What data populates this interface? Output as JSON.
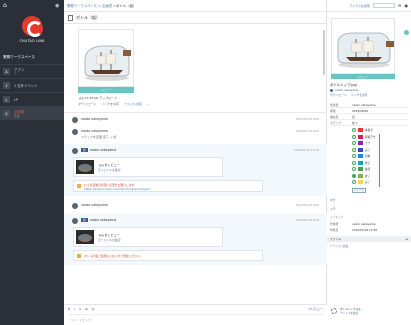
{
  "sidebar": {
    "logo_text": "CHUTAO LINK",
    "section_label": "業務ワークスペース",
    "items": [
      {
        "badge": "A",
        "label": "アプリ",
        "sub": "ア"
      },
      {
        "badge": "1",
        "label": "1 社外イベント",
        "sub": ""
      },
      {
        "badge": "L",
        "label": "LP",
        "sub": ""
      },
      {
        "badge": "S",
        "label": "企画書",
        "sub": "企画"
      }
    ]
  },
  "header": {
    "breadcrumb": "業務ワークスペース > 企画書 > ",
    "breadcrumb_current": "ボトル（仮）",
    "search_label": "アイテムを検索"
  },
  "title_bar": {
    "title": "ボトル（仮）"
  },
  "main": {
    "preview_button": "レビュー",
    "file_info": ".jpg 13.58 KB アップロード",
    "file_actions": [
      "ダウンロード",
      "リンクを共有",
      "ファイル共有",
      "…"
    ],
    "messages": [
      {
        "name": "naoto nakayama",
        "time": "2019/01/18 8:00",
        "text": ""
      },
      {
        "name": "naoto nakayama",
        "time": "2019/01/18 8:00",
        "text": "ステップを変更  完了 → 仮"
      }
    ],
    "highlight": {
      "tag": "仮",
      "name": "naoto nakayama",
      "time": "2019/01/18 13:38",
      "attachment_name": ".jpg をレビュー",
      "attachment_link": "元ファイルを確認",
      "note_text": "ロゴを画像の意図に変更をお願いします。",
      "note_url": "https://www.dropbox.com/home/xg/work/logo/d"
    },
    "message3": {
      "name": "naoto nakayama",
      "time": "2019/01/18 8:00"
    },
    "highlight2": {
      "tag": "仮",
      "name": "naoto nakayama",
      "time": "2019/01/18 8:38",
      "attachment_name": ".jpg をレビュー",
      "attachment_link": "元ファイルを確認",
      "note_text": "ボトルの瓶と装飾もいないかで修復ください。"
    },
    "footer": {
      "tools": [
        "B",
        "I",
        "U",
        "⊞",
        "@"
      ],
      "preview_toggle": "プレビュー",
      "input_placeholder": "コメントを入力"
    }
  },
  "right": {
    "preview_button": "レビュー",
    "file_name": "ボトルシップ.jpg",
    "owner": "naoto nakayama",
    "actions": [
      "ダウンロード",
      "リンクを共有"
    ],
    "info": [
      {
        "k": "担当者",
        "v": "naoto nakayama"
      },
      {
        "k": "期限",
        "v": "2019/06/20"
      },
      {
        "k": "優先度",
        "v": "高"
      },
      {
        "k": "ステップ",
        "v": "仮 1"
      }
    ],
    "statuses": [
      {
        "label": "未着手",
        "color": "#e53935"
      },
      {
        "label": "原稿アサ",
        "color": "#d81b60"
      },
      {
        "label": "ラフ",
        "color": "#8e24aa"
      },
      {
        "label": "完了",
        "color": "#3949ab"
      },
      {
        "label": "初稿",
        "color": "#1e88e5"
      },
      {
        "label": "修正",
        "color": "#00acc1"
      },
      {
        "label": "確認",
        "color": "#43a047"
      },
      {
        "label": "校了",
        "color": "#7cb342"
      },
      {
        "label": "完了",
        "color": "#fdd835"
      }
    ],
    "status_button": "アイテム",
    "tag_label": "タグ",
    "memo_label": "メモ",
    "memo_placeholder": "メモを入力",
    "meta": [
      {
        "k": "作成者",
        "v": "naoto nakayama"
      },
      {
        "k": "作成日",
        "v": "2019/01/18 13:58"
      }
    ],
    "tabs": {
      "left": "ファイル",
      "right": "≡"
    },
    "version_label": "バージョン追加",
    "file_row": {
      "name": "ボトルシップ.jpg",
      "sub": "ファイルを確認"
    }
  }
}
